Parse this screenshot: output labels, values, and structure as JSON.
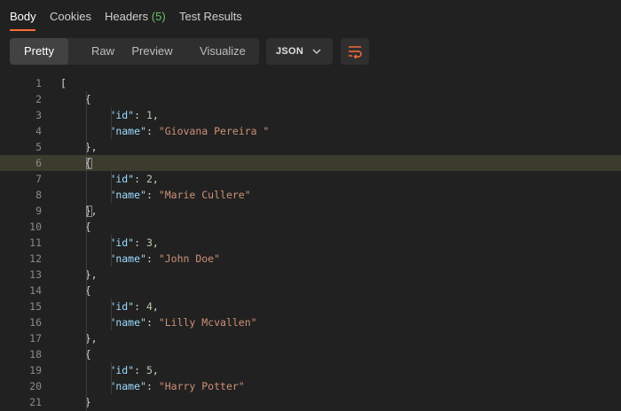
{
  "tabs": [
    {
      "label": "Body"
    },
    {
      "label": "Cookies"
    },
    {
      "label": "Headers",
      "count": "(5)"
    },
    {
      "label": "Test Results"
    }
  ],
  "view_modes": [
    "Pretty",
    "Raw",
    "Preview",
    "Visualize"
  ],
  "format": {
    "selected": "JSON"
  },
  "icons": {
    "format_chevron": "chevron-down-icon",
    "wrap": "wrap-lines-icon"
  },
  "colors": {
    "accent": "#ff6c37",
    "count": "#6cc070",
    "key": "#9cdcfe",
    "number": "#b5cea8",
    "string": "#ce9178",
    "highlight_line": "#3b3b2e"
  },
  "editor": {
    "highlighted_line": 6,
    "lines": [
      {
        "n": "1",
        "tokens": [
          {
            "t": "[",
            "c": "p"
          }
        ]
      },
      {
        "n": "2",
        "tokens": [
          {
            "t": "    {",
            "c": "p"
          }
        ]
      },
      {
        "n": "3",
        "tokens": [
          {
            "t": "        ",
            "c": "p"
          },
          {
            "t": "\"id\"",
            "c": "k"
          },
          {
            "t": ": ",
            "c": "p"
          },
          {
            "t": "1",
            "c": "n"
          },
          {
            "t": ",",
            "c": "p"
          }
        ]
      },
      {
        "n": "4",
        "tokens": [
          {
            "t": "        ",
            "c": "p"
          },
          {
            "t": "\"name\"",
            "c": "k"
          },
          {
            "t": ": ",
            "c": "p"
          },
          {
            "t": "\"Giovana Pereira \"",
            "c": "s"
          }
        ]
      },
      {
        "n": "5",
        "tokens": [
          {
            "t": "    },",
            "c": "p"
          }
        ]
      },
      {
        "n": "6",
        "tokens": [
          {
            "t": "    {",
            "c": "p"
          }
        ]
      },
      {
        "n": "7",
        "tokens": [
          {
            "t": "        ",
            "c": "p"
          },
          {
            "t": "\"id\"",
            "c": "k"
          },
          {
            "t": ": ",
            "c": "p"
          },
          {
            "t": "2",
            "c": "n"
          },
          {
            "t": ",",
            "c": "p"
          }
        ]
      },
      {
        "n": "8",
        "tokens": [
          {
            "t": "        ",
            "c": "p"
          },
          {
            "t": "\"name\"",
            "c": "k"
          },
          {
            "t": ": ",
            "c": "p"
          },
          {
            "t": "\"Marie Cullere\"",
            "c": "s"
          }
        ]
      },
      {
        "n": "9",
        "tokens": [
          {
            "t": "    },",
            "c": "p"
          }
        ]
      },
      {
        "n": "10",
        "tokens": [
          {
            "t": "    {",
            "c": "p"
          }
        ]
      },
      {
        "n": "11",
        "tokens": [
          {
            "t": "        ",
            "c": "p"
          },
          {
            "t": "\"id\"",
            "c": "k"
          },
          {
            "t": ": ",
            "c": "p"
          },
          {
            "t": "3",
            "c": "n"
          },
          {
            "t": ",",
            "c": "p"
          }
        ]
      },
      {
        "n": "12",
        "tokens": [
          {
            "t": "        ",
            "c": "p"
          },
          {
            "t": "\"name\"",
            "c": "k"
          },
          {
            "t": ": ",
            "c": "p"
          },
          {
            "t": "\"John Doe\"",
            "c": "s"
          }
        ]
      },
      {
        "n": "13",
        "tokens": [
          {
            "t": "    },",
            "c": "p"
          }
        ]
      },
      {
        "n": "14",
        "tokens": [
          {
            "t": "    {",
            "c": "p"
          }
        ]
      },
      {
        "n": "15",
        "tokens": [
          {
            "t": "        ",
            "c": "p"
          },
          {
            "t": "\"id\"",
            "c": "k"
          },
          {
            "t": ": ",
            "c": "p"
          },
          {
            "t": "4",
            "c": "n"
          },
          {
            "t": ",",
            "c": "p"
          }
        ]
      },
      {
        "n": "16",
        "tokens": [
          {
            "t": "        ",
            "c": "p"
          },
          {
            "t": "\"name\"",
            "c": "k"
          },
          {
            "t": ": ",
            "c": "p"
          },
          {
            "t": "\"Lilly Mcvallen\"",
            "c": "s"
          }
        ]
      },
      {
        "n": "17",
        "tokens": [
          {
            "t": "    },",
            "c": "p"
          }
        ]
      },
      {
        "n": "18",
        "tokens": [
          {
            "t": "    {",
            "c": "p"
          }
        ]
      },
      {
        "n": "19",
        "tokens": [
          {
            "t": "        ",
            "c": "p"
          },
          {
            "t": "\"id\"",
            "c": "k"
          },
          {
            "t": ": ",
            "c": "p"
          },
          {
            "t": "5",
            "c": "n"
          },
          {
            "t": ",",
            "c": "p"
          }
        ]
      },
      {
        "n": "20",
        "tokens": [
          {
            "t": "        ",
            "c": "p"
          },
          {
            "t": "\"name\"",
            "c": "k"
          },
          {
            "t": ": ",
            "c": "p"
          },
          {
            "t": "\"Harry Potter\"",
            "c": "s"
          }
        ]
      },
      {
        "n": "21",
        "tokens": [
          {
            "t": "    }",
            "c": "p"
          }
        ]
      }
    ]
  }
}
